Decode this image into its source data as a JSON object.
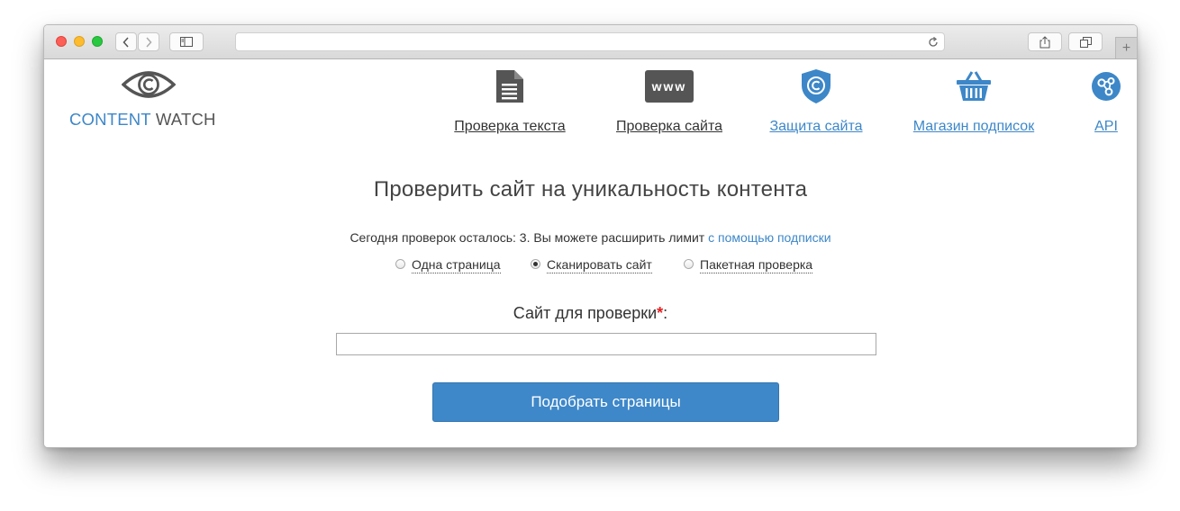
{
  "browser": {
    "icons": {
      "back": "chevron-left-icon",
      "forward": "chevron-right-icon",
      "sidebar": "sidebar-icon",
      "reload": "reload-icon",
      "share": "share-icon",
      "tabs": "tabs-icon",
      "new_tab": "+"
    }
  },
  "logo": {
    "part1": "CONTENT",
    "part2": "WATCH"
  },
  "nav": [
    {
      "label": "Проверка текста",
      "icon": "document-icon"
    },
    {
      "label": "Проверка сайта",
      "icon": "www-icon",
      "icon_text": "www"
    },
    {
      "label": "Защита сайта",
      "icon": "shield-icon"
    },
    {
      "label": "Магазин подписок",
      "icon": "basket-icon"
    },
    {
      "label": "API",
      "icon": "api-icon"
    }
  ],
  "colors": {
    "accent": "#3d87c8",
    "button": "#3e88c9",
    "required": "#e02020"
  },
  "main": {
    "title": "Проверить сайт на уникальность контента",
    "limit_text": "Сегодня проверок осталось: 3. Вы можете расширить лимит",
    "limit_link": "с помощью подписки",
    "modes": [
      {
        "label": "Одна страница",
        "selected": false
      },
      {
        "label": "Сканировать сайт",
        "selected": true
      },
      {
        "label": "Пакетная проверка",
        "selected": false
      }
    ],
    "field_label": "Сайт для проверки",
    "required_mark": "*",
    "field_colon": ":",
    "field_value": "",
    "submit_label": "Подобрать страницы"
  }
}
